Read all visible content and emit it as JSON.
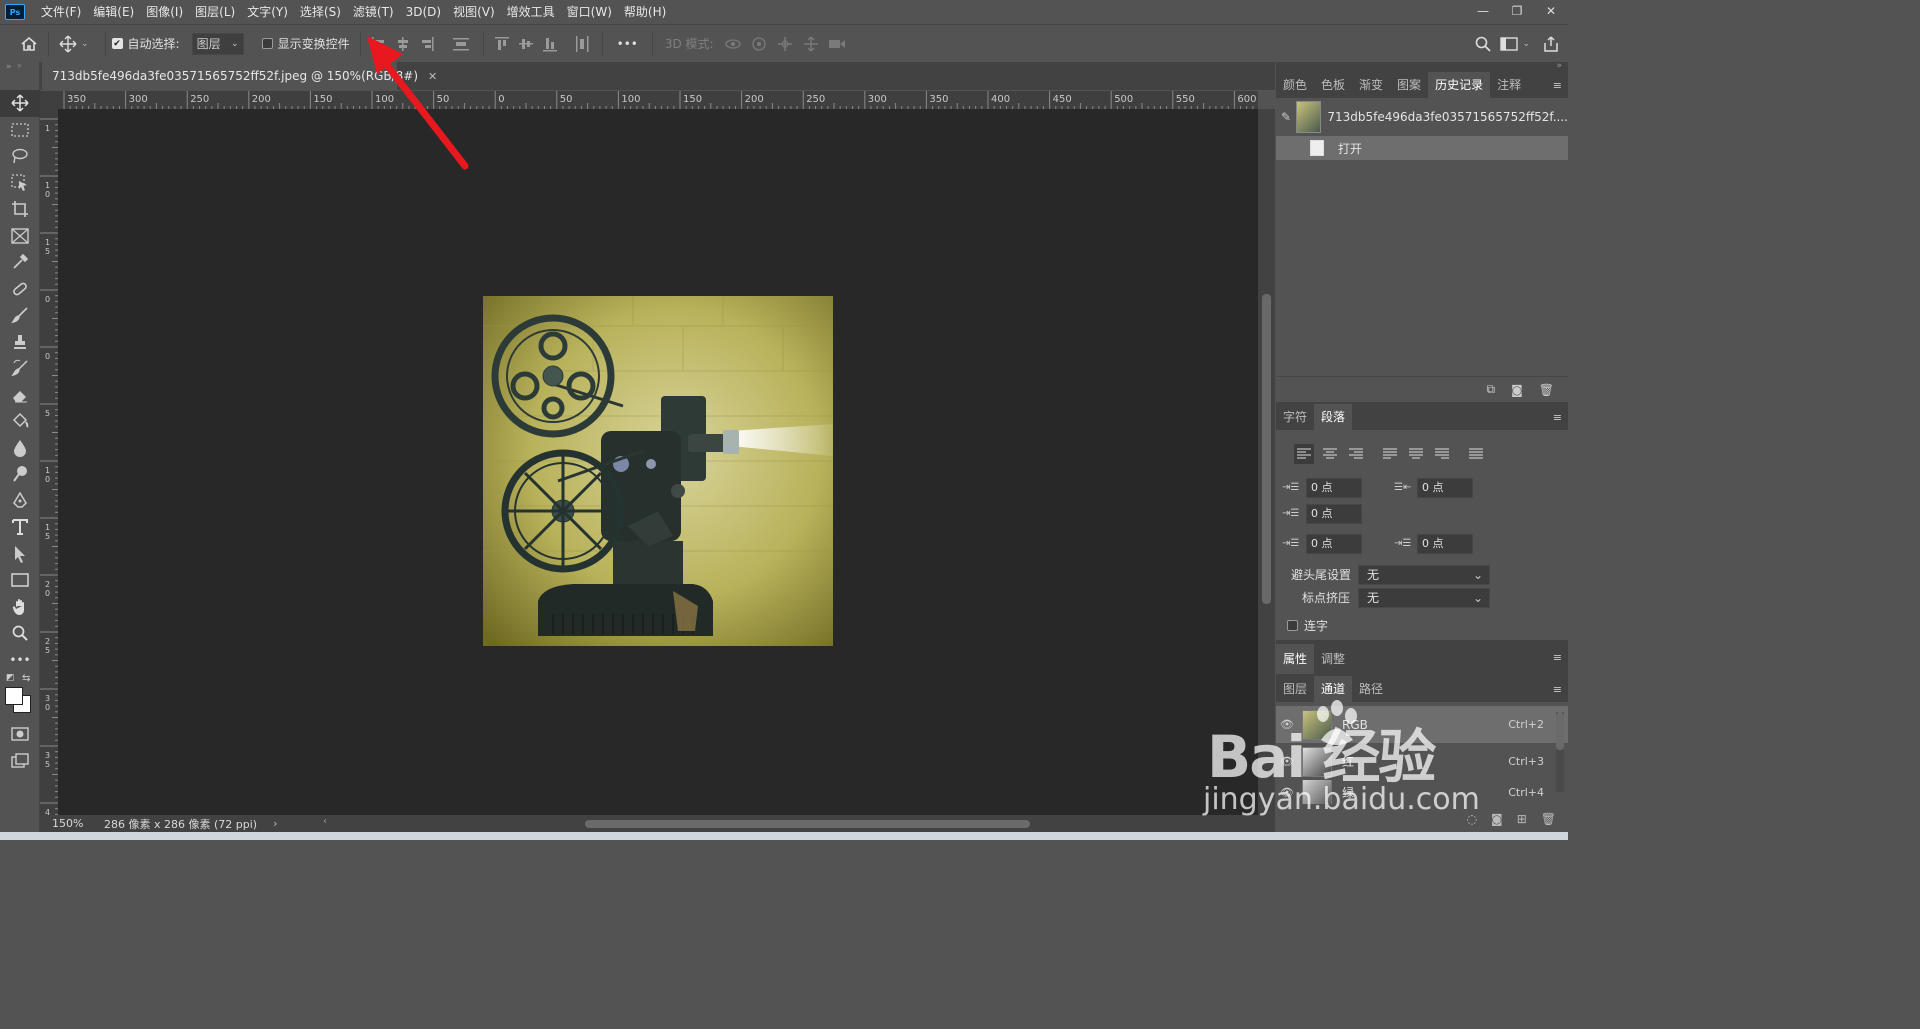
{
  "app": {
    "logo": "Ps"
  },
  "menu": [
    "文件(F)",
    "编辑(E)",
    "图像(I)",
    "图层(L)",
    "文字(Y)",
    "选择(S)",
    "滤镜(T)",
    "3D(D)",
    "视图(V)",
    "增效工具",
    "窗口(W)",
    "帮助(H)"
  ],
  "window_controls": {
    "minimize": "—",
    "restore": "❐",
    "close": "✕"
  },
  "options": {
    "auto_select_label": "自动选择:",
    "auto_select_checked": true,
    "layer_dropdown": "图层",
    "show_transform_label": "显示变换控件",
    "show_transform_checked": false,
    "more": "•••",
    "mode_3d_label": "3D 模式:"
  },
  "document": {
    "tab_title": "713db5fe496da3fe03571565752ff52f.jpeg @ 150%(RGB/8#)",
    "close": "✕",
    "zoom": "150%",
    "doc_info": "286 像素 x 286 像素 (72 ppi)",
    "ruler_h_labels": [
      "350",
      "300",
      "250",
      "200",
      "150",
      "100",
      "50",
      "0",
      "50",
      "100",
      "150",
      "200",
      "250",
      "300",
      "350",
      "400",
      "450",
      "500",
      "550",
      "600"
    ],
    "ruler_v_labels": [
      "1",
      "1\n0",
      "1\n5",
      "0",
      "0",
      "5",
      "1\n0",
      "1\n5",
      "2\n0",
      "2\n5",
      "3\n0",
      "3\n5",
      "4\n0"
    ]
  },
  "history_panel": {
    "tabs": [
      "颜色",
      "色板",
      "渐变",
      "图案",
      "历史记录",
      "注释"
    ],
    "active_tab": "历史记录",
    "snapshot_name": "713db5fe496da3fe03571565752ff52f....",
    "items": [
      "打开"
    ]
  },
  "paragraph_panel": {
    "tabs": [
      "字符",
      "段落"
    ],
    "active_tab": "段落",
    "indent_left": "0 点",
    "indent_right": "0 点",
    "indent_first": "0 点",
    "space_before": "0 点",
    "space_after": "0 点",
    "hyphenation_label": "避头尾设置",
    "hyphenation_value": "无",
    "punct_label": "标点挤压",
    "punct_value": "无",
    "hyphenate_label": "连字"
  },
  "properties_panel": {
    "tabs": [
      "属性",
      "调整"
    ],
    "active_tab": "属性"
  },
  "channels_panel": {
    "tabs": [
      "图层",
      "通道",
      "路径"
    ],
    "active_tab": "通道",
    "channels": [
      {
        "name": "RGB",
        "shortcut": "Ctrl+2"
      },
      {
        "name": "红",
        "shortcut": "Ctrl+3"
      },
      {
        "name": "绿",
        "shortcut": "Ctrl+4"
      }
    ]
  },
  "watermark": {
    "logo": "Bai  经验",
    "url": "jingyan.baidu.com"
  },
  "colors": {
    "accent_red": "#e8191e",
    "ui_bg": "#535353",
    "canvas_bg": "#282828"
  }
}
